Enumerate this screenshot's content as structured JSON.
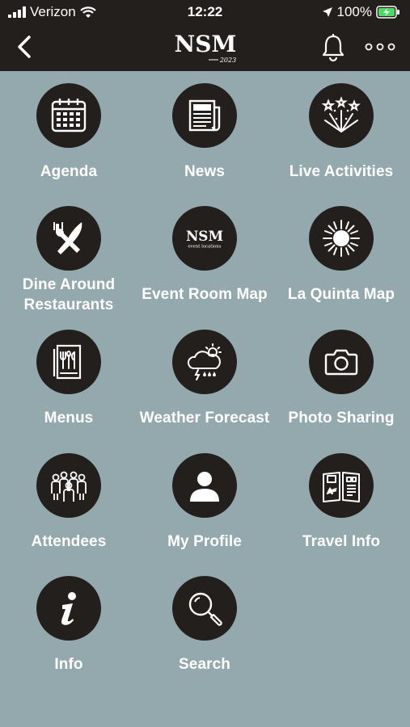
{
  "status_bar": {
    "carrier": "Verizon",
    "time": "12:22",
    "battery": "100%"
  },
  "nav": {
    "logo_text": "NSM",
    "logo_year": "2023",
    "icons": [
      "back-arrow-icon",
      "bell-icon",
      "more-dots-icon"
    ]
  },
  "menu": [
    {
      "label": "Agenda",
      "icon": "calendar-icon"
    },
    {
      "label": "News",
      "icon": "newspaper-icon"
    },
    {
      "label": "Live Activities",
      "icon": "fireworks-icon"
    },
    {
      "label": "Dine Around Restaurants",
      "icon": "fork-knife-icon"
    },
    {
      "label": "Event Room Map",
      "icon": "nsm-event-locations-icon",
      "icon_text": "NSM",
      "icon_subtext": "event locations"
    },
    {
      "label": "La Quinta Map",
      "icon": "sun-burst-icon"
    },
    {
      "label": "Menus",
      "icon": "menu-book-icon"
    },
    {
      "label": "Weather Forecast",
      "icon": "weather-cloud-icon"
    },
    {
      "label": "Photo Sharing",
      "icon": "camera-icon"
    },
    {
      "label": "Attendees",
      "icon": "people-group-icon"
    },
    {
      "label": "My Profile",
      "icon": "user-profile-icon"
    },
    {
      "label": "Travel Info",
      "icon": "travel-map-icon"
    },
    {
      "label": "Info",
      "icon": "info-icon"
    },
    {
      "label": "Search",
      "icon": "magnifier-icon"
    }
  ],
  "colors": {
    "background": "#93a9ad",
    "bar": "#231f1d",
    "circle": "#231f1d",
    "text": "#ffffff"
  }
}
